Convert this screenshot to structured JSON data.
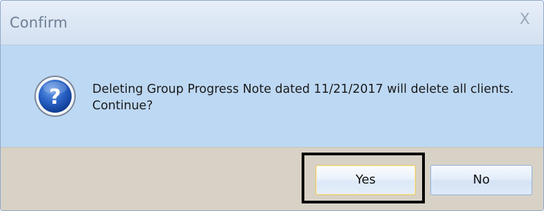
{
  "dialog": {
    "title": "Confirm",
    "close_label": "X",
    "icon": "question-icon",
    "message": "Deleting Group Progress Note dated 11/21/2017 will delete all clients. Continue?",
    "buttons": {
      "yes_label": "Yes",
      "no_label": "No"
    }
  },
  "colors": {
    "content_background": "#bdd8f3",
    "button_bar_background": "#d8d2c6",
    "highlight_border": "#000000"
  }
}
